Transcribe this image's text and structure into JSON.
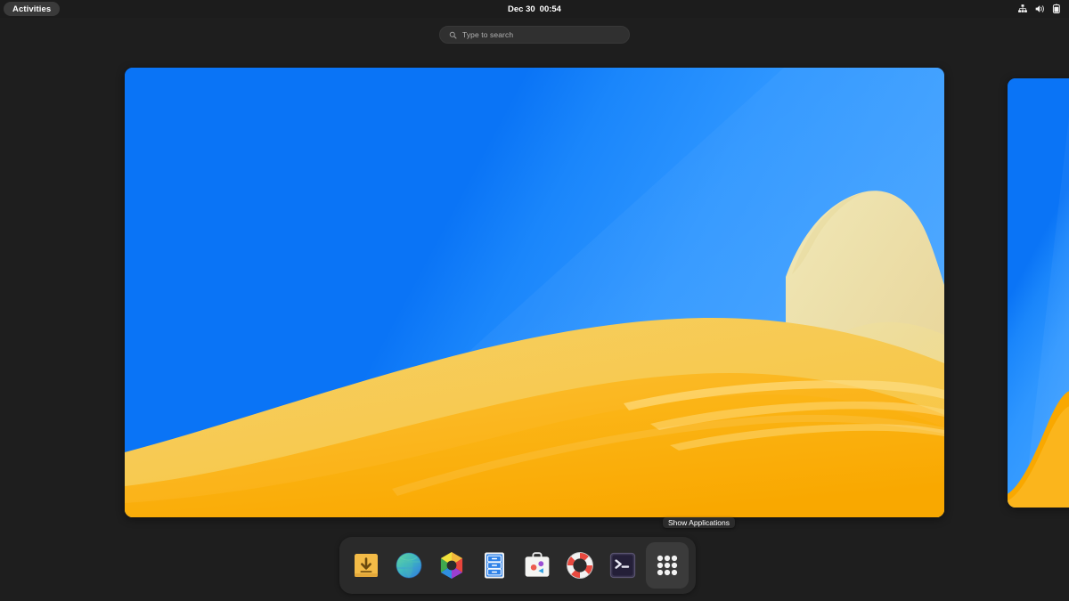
{
  "topbar": {
    "activities_label": "Activities",
    "clock": {
      "date": "Dec 30",
      "time": "00:54"
    },
    "status_icons": [
      {
        "name": "network-wired-icon",
        "label": "Wired Network"
      },
      {
        "name": "volume-icon",
        "label": "Volume"
      },
      {
        "name": "battery-icon",
        "label": "Battery"
      }
    ]
  },
  "search": {
    "placeholder": "Type to search",
    "value": "",
    "icon": "search-icon"
  },
  "overview": {
    "workspaces": [
      {
        "name": "workspace-active",
        "index": 1,
        "active": true
      },
      {
        "name": "workspace-next",
        "index": 2,
        "active": false
      }
    ],
    "wallpaper": {
      "name": "dune-wallpaper",
      "sky_color_start": "#0a74f6",
      "sky_color_end": "#48a6ff",
      "sand_color_main": "#fbb215",
      "sand_color_mid": "#f6c84b",
      "sand_color_light": "#ecd98f",
      "sand_color_pale": "#ebe2ac"
    }
  },
  "tooltip": {
    "text": "Show Applications"
  },
  "dock": {
    "items": [
      {
        "name": "dock-item-downloads",
        "label": "Downloads",
        "icon": "download-box-icon"
      },
      {
        "name": "dock-item-web",
        "label": "Web",
        "icon": "globe-icon"
      },
      {
        "name": "dock-item-photos",
        "label": "Photos",
        "icon": "hexagon-aperture-icon"
      },
      {
        "name": "dock-item-files",
        "label": "Files",
        "icon": "file-cabinet-icon"
      },
      {
        "name": "dock-item-software",
        "label": "Software",
        "icon": "briefcase-icon"
      },
      {
        "name": "dock-item-help",
        "label": "Help",
        "icon": "lifering-icon"
      },
      {
        "name": "dock-item-terminal",
        "label": "Terminal",
        "icon": "terminal-icon"
      },
      {
        "name": "dock-item-show-apps",
        "label": "Show Applications",
        "icon": "grid-dots-icon"
      }
    ]
  },
  "colors": {
    "topbar_bg": "#1c1c1c",
    "desktop_bg": "#1e1e1e",
    "dock_bg": "#2a2a2a",
    "accent_blue": "#0a74f6",
    "accent_orange": "#fbb215"
  }
}
